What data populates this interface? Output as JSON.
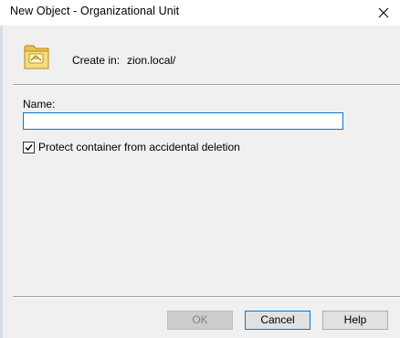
{
  "window": {
    "title": "New Object - Organizational Unit",
    "close_glyph": "✕"
  },
  "create_in": {
    "icon": "ou-folder-icon",
    "label": "Create in:",
    "value": "zion.local/"
  },
  "name_field": {
    "label": "Name:",
    "value": ""
  },
  "protect": {
    "label": "Protect container from accidental deletion",
    "checked": true
  },
  "buttons": {
    "ok": "OK",
    "cancel": "Cancel",
    "help": "Help"
  },
  "colors": {
    "accent": "#0078d7",
    "dialog_bg": "#f0f0f0"
  }
}
